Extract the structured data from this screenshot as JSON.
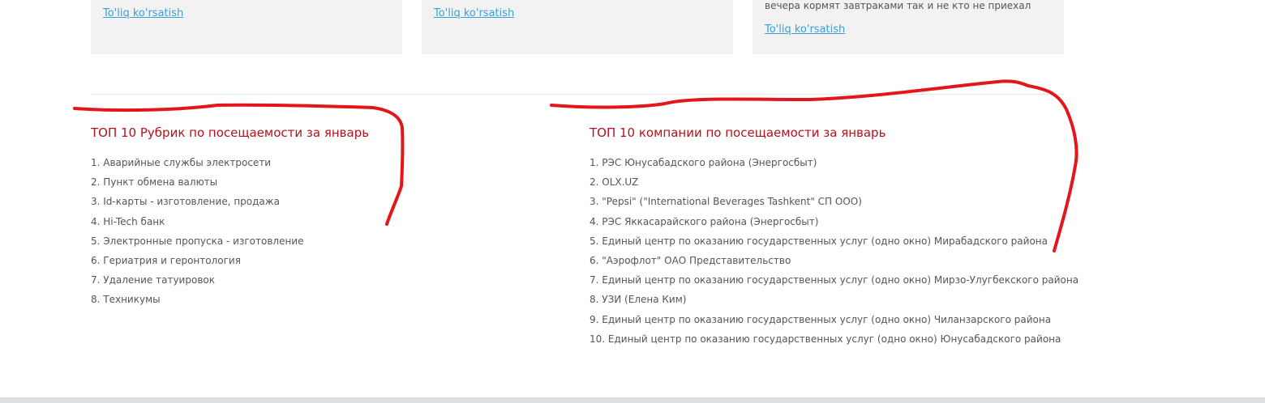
{
  "cards": [
    {
      "text": "",
      "more_link": "To'liq ko'rsatish"
    },
    {
      "text": "",
      "more_link": "To'liq ko'rsatish"
    },
    {
      "text": "вечера кормят завтраками так и не кто не приехал",
      "more_link": "To'liq ko'rsatish"
    }
  ],
  "rubrics": {
    "title": "ТОП 10 Рубрик по посещаемости за январь",
    "items": [
      "1. Аварийные службы электросети",
      "2. Пункт обмена валюты",
      "3. Id-карты - изготовление, продажа",
      "4. Hi-Tech банк",
      "5. Электронные пропуска - изготовление",
      "6. Гериатрия и геронтология",
      "7. Удаление татуировок",
      "8. Техникумы"
    ]
  },
  "companies": {
    "title": "ТОП 10 компании по посещаемости за январь",
    "items": [
      "1. РЭС Юнусабадского района (Энергосбыт)",
      "2. OLX.UZ",
      "3. \"Pepsi\" (\"International Beverages Tashkent\" СП ООО)",
      "4. РЭС Яккасарайского района (Энергосбыт)",
      "5. Единый центр по оказанию государственных услуг (одно окно) Мирабадского района",
      "6. \"Аэрофлот\" ОАО Представительство",
      "7. Единый центр по оказанию государственных услуг (одно окно) Мирзо-Улугбекского района",
      "8. УЗИ (Елена Ким)",
      "9. Единый центр по оказанию государственных услуг (одно окно) Чиланзарского района",
      "10. Единый центр по оказанию государственных услуг (одно окно) Юнусабадского района"
    ]
  },
  "colors": {
    "title_red": "#b5121b",
    "link_blue": "#3aa0d8",
    "card_bg": "#f2f2f2",
    "annotation_red": "#e3171b"
  }
}
